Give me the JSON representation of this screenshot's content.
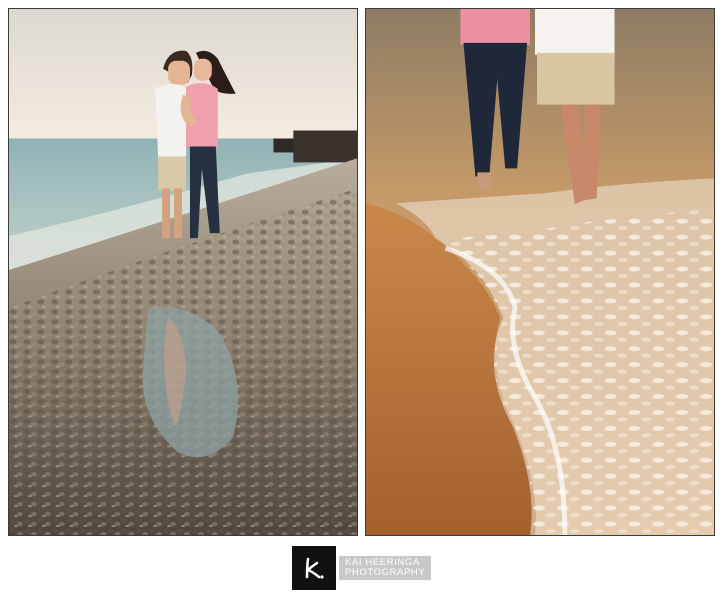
{
  "photos": [
    {
      "subject": "couple-kissing-on-pebble-beach",
      "palette": {
        "sky": "#f2ebde",
        "water": "#a7c1c1",
        "pebbles": "#7d7262",
        "shirt": "#f0a0ac",
        "jeans": "#253040"
      }
    },
    {
      "subject": "couple-feet-walking-in-surf",
      "palette": {
        "sand": "#b9763f",
        "foam": "#f1e7da",
        "water": "#c79560",
        "jeans": "#1f2838",
        "shorts": "#d9c7a2"
      }
    }
  ],
  "logo": {
    "line1": "KAI HEERINGA",
    "line2": "PHOTOGRAPHY",
    "mark_background": "#111111",
    "text_background": "#c8c8c8"
  }
}
